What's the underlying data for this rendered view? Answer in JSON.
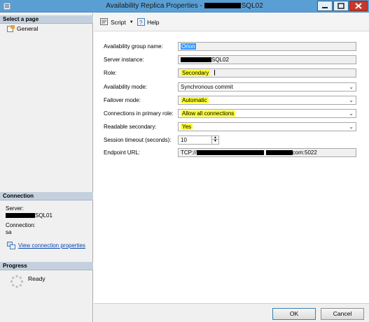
{
  "window": {
    "title_prefix": "Availability Replica Properties - ",
    "title_suffix": "SQL02"
  },
  "left_pane": {
    "select_page_header": "Select a page",
    "pages": [
      {
        "label": "General"
      }
    ],
    "connection_header": "Connection",
    "server_label": "Server:",
    "server_value_suffix": "SQL01",
    "connection_label": "Connection:",
    "connection_value": "sa",
    "view_connection_link": "View connection properties",
    "progress_header": "Progress",
    "progress_status": "Ready"
  },
  "toolbar": {
    "script_label": "Script",
    "help_label": "Help"
  },
  "form": {
    "availability_group_name": {
      "label": "Availability group name:",
      "value": "Orion"
    },
    "server_instance": {
      "label": "Server instance:",
      "value_suffix": "SQL02"
    },
    "role": {
      "label": "Role:",
      "value": "Secondary"
    },
    "availability_mode": {
      "label": "Availability mode:",
      "value": "Synchronous commit"
    },
    "failover_mode": {
      "label": "Failover mode:",
      "value": "Automatic"
    },
    "connections_in_primary_role": {
      "label": "Connections in primary role:",
      "value": "Allow all connections"
    },
    "readable_secondary": {
      "label": "Readable secondary:",
      "value": "Yes"
    },
    "session_timeout": {
      "label": "Session timeout (seconds):",
      "value": "10"
    },
    "endpoint_url": {
      "label": "Endpoint URL:",
      "value_prefix": "TCP://",
      "value_suffix": "com:5022"
    }
  },
  "buttons": {
    "ok": "OK",
    "cancel": "Cancel"
  },
  "colors": {
    "titlebar": "#5a9fd4",
    "highlight": "#ffff33",
    "selection": "#3399ff",
    "link": "#0645ad"
  }
}
